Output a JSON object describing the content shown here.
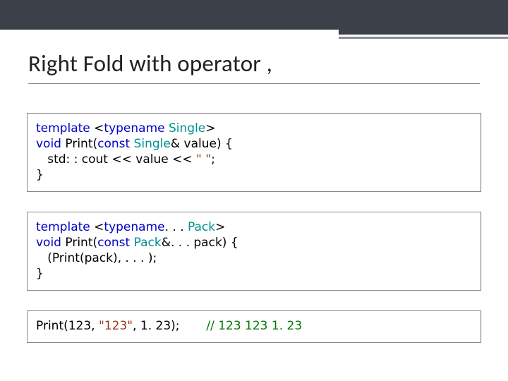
{
  "title": "Right Fold with operator ,",
  "code_blocks": [
    {
      "lines": [
        [
          {
            "t": "template",
            "c": "kw"
          },
          {
            "t": " <",
            "c": ""
          },
          {
            "t": "typename",
            "c": "kw"
          },
          {
            "t": " ",
            "c": ""
          },
          {
            "t": "Single",
            "c": "type"
          },
          {
            "t": ">",
            "c": ""
          }
        ],
        [
          {
            "t": "void",
            "c": "kw"
          },
          {
            "t": " Print(",
            "c": ""
          },
          {
            "t": "const",
            "c": "kw"
          },
          {
            "t": " ",
            "c": ""
          },
          {
            "t": "Single",
            "c": "type"
          },
          {
            "t": "& value) {",
            "c": ""
          }
        ],
        [
          {
            "t": "   std: : cout << value << ",
            "c": ""
          },
          {
            "t": "\" \"",
            "c": "str"
          },
          {
            "t": ";",
            "c": ""
          }
        ],
        [
          {
            "t": "}",
            "c": ""
          }
        ]
      ]
    },
    {
      "lines": [
        [
          {
            "t": "template",
            "c": "kw"
          },
          {
            "t": " <",
            "c": ""
          },
          {
            "t": "typename",
            "c": "kw"
          },
          {
            "t": ". . . ",
            "c": ""
          },
          {
            "t": "Pack",
            "c": "type"
          },
          {
            "t": ">",
            "c": ""
          }
        ],
        [
          {
            "t": "void",
            "c": "kw"
          },
          {
            "t": " Print(",
            "c": ""
          },
          {
            "t": "const",
            "c": "kw"
          },
          {
            "t": " ",
            "c": ""
          },
          {
            "t": "Pack",
            "c": "type"
          },
          {
            "t": "&. . . pack) {",
            "c": ""
          }
        ],
        [
          {
            "t": "   (Print(pack), . . . );",
            "c": ""
          }
        ],
        [
          {
            "t": "}",
            "c": ""
          }
        ]
      ]
    },
    {
      "lines": [
        [
          {
            "t": "Print(123, ",
            "c": ""
          },
          {
            "t": "\"123\"",
            "c": "str"
          },
          {
            "t": ", 1. 23);       ",
            "c": ""
          },
          {
            "t": "// 123 123 1. 23",
            "c": "cmt"
          }
        ]
      ]
    }
  ]
}
